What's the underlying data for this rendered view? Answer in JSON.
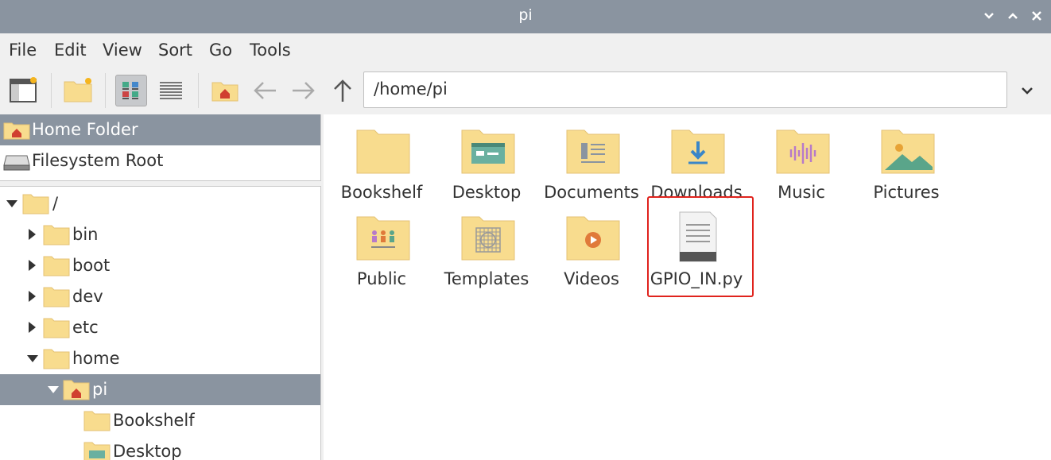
{
  "window": {
    "title": "pi"
  },
  "menu": [
    "File",
    "Edit",
    "View",
    "Sort",
    "Go",
    "Tools"
  ],
  "toolbar": {
    "path_value": "/home/pi",
    "buttons": [
      "new-window",
      "new-folder",
      "icon-view",
      "list-view",
      "home",
      "back",
      "forward",
      "up"
    ]
  },
  "places": [
    {
      "label": "Home Folder",
      "selected": true
    },
    {
      "label": "Filesystem Root",
      "selected": false
    }
  ],
  "tree": [
    {
      "label": "/",
      "expanded": true
    },
    {
      "label": "bin"
    },
    {
      "label": "boot"
    },
    {
      "label": "dev"
    },
    {
      "label": "etc"
    },
    {
      "label": "home",
      "expanded": true
    },
    {
      "label": "pi",
      "selected": true,
      "expanded": true
    },
    {
      "label": "Bookshelf"
    },
    {
      "label": "Desktop"
    }
  ],
  "files": [
    {
      "label": "Bookshelf",
      "icon": "folder-icon"
    },
    {
      "label": "Desktop",
      "icon": "folder-desktop-icon"
    },
    {
      "label": "Documents",
      "icon": "folder-documents-icon"
    },
    {
      "label": "Downloads",
      "icon": "folder-downloads-icon"
    },
    {
      "label": "Music",
      "icon": "folder-music-icon"
    },
    {
      "label": "Pictures",
      "icon": "folder-pictures-icon"
    },
    {
      "label": "Public",
      "icon": "folder-public-icon"
    },
    {
      "label": "Templates",
      "icon": "folder-templates-icon"
    },
    {
      "label": "Videos",
      "icon": "folder-videos-icon"
    },
    {
      "label": "GPIO_IN.py",
      "icon": "text-file-icon"
    }
  ],
  "colors": {
    "titlebar": "#8a94a0",
    "selection": "#8a94a0",
    "folder": "#f8dc8e",
    "folder_edge": "#e4c274",
    "highlight": "#e0231d"
  }
}
